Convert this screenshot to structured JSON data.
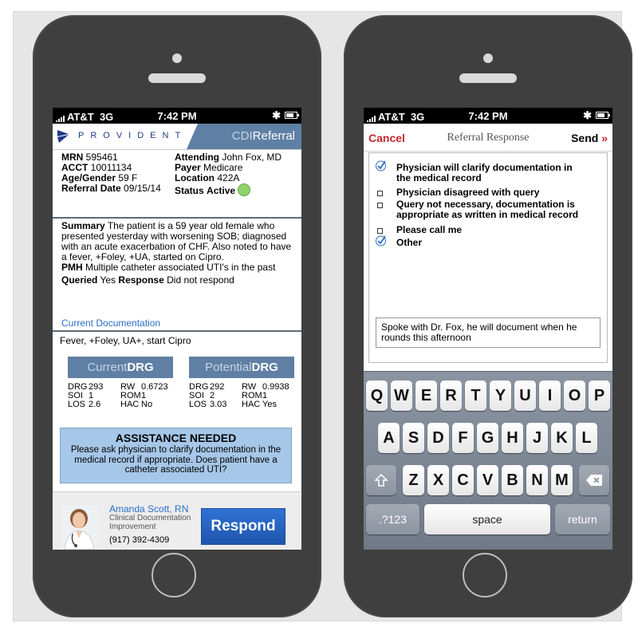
{
  "left_screen": {
    "status": {
      "carrier": "AT&T",
      "network": "3G",
      "time": "7:42 PM",
      "bluetooth": "✱"
    },
    "brand": {
      "name": "PROVIDENT",
      "product_light": "CDI",
      "product_bold": "Referral"
    },
    "patient": {
      "mrn_label": "MRN",
      "mrn": "595461",
      "acct_label": "ACCT",
      "acct": "10011134",
      "age_label": "Age/Gender",
      "age": "59 F",
      "refdate_label": "Referral Date",
      "refdate": "09/15/14",
      "attending_label": "Attending",
      "attending": "John Fox, MD",
      "payer_label": "Payer",
      "payer": "Medicare",
      "location_label": "Location",
      "location": "422A",
      "status_label": "Status",
      "status": "Active"
    },
    "summary": {
      "summary_label": "Summary",
      "summary_text": "The patient is a 59 year old female who presented yesterday with worsening SOB; diagnosed with an acute exacerbation of CHF. Also noted to have a fever, +Foley, +UA, started on Cipro.",
      "pmh_label": "PMH",
      "pmh_text": "Multiple catheter associated  UTI's in the past",
      "queried_label": "Queried",
      "queried": "Yes",
      "response_label": "Response",
      "response": "Did not respond"
    },
    "current_doc_link": "Current Documentation",
    "current_doc_text": "Fever, +Foley, UA+, start Cipro",
    "current_drg": {
      "title_light": "Current",
      "title_bold": "DRG",
      "rows": [
        {
          "k1": "DRG",
          "v1": "293",
          "k2": "RW",
          "v2": "0.6723"
        },
        {
          "k1": "SOI",
          "v1": "1",
          "k2": "ROM",
          "v2": "1"
        },
        {
          "k1": "LOS",
          "v1": "2.6",
          "k2": "HAC",
          "v2": "No"
        }
      ]
    },
    "potential_drg": {
      "title_light": "Potential",
      "title_bold": "DRG",
      "rows": [
        {
          "k1": "DRG",
          "v1": "292",
          "k2": "RW",
          "v2": "0.9938"
        },
        {
          "k1": "SOI",
          "v1": "2",
          "k2": "ROM",
          "v2": "1"
        },
        {
          "k1": "LOS",
          "v1": "3.03",
          "k2": "HAC",
          "v2": "Yes"
        }
      ]
    },
    "assistance": {
      "title": "ASSISTANCE NEEDED",
      "text": "Please ask physician to clarify documentation in the medical record if appropriate. Does patient have a catheter associated UTI?"
    },
    "contact": {
      "name": "Amanda Scott, RN",
      "role": "Clinical Documentation Improvement",
      "phone": "(917) 392-4309"
    },
    "respond_label": "Respond"
  },
  "right_screen": {
    "status": {
      "carrier": "AT&T",
      "network": "3G",
      "time": "7:42 PM",
      "bluetooth": "✱"
    },
    "nav": {
      "cancel": "Cancel",
      "title": "Referral Response",
      "send": "Send",
      "send_chevron": "»"
    },
    "options": [
      {
        "text": "Physician will clarify documentation in the medical record",
        "checked": true
      },
      {
        "text": "Physician disagreed with query",
        "checked": false
      },
      {
        "text": "Query not necessary, documentation is appropriate as written in medical record",
        "checked": false
      },
      {
        "text": "Please call me",
        "checked": false
      },
      {
        "text": "Other",
        "checked": true
      }
    ],
    "note": "Spoke with Dr. Fox, he will document when he rounds this afternoon",
    "keyboard": {
      "row1": [
        "Q",
        "W",
        "E",
        "R",
        "T",
        "Y",
        "U",
        "I",
        "O",
        "P"
      ],
      "row2": [
        "A",
        "S",
        "D",
        "F",
        "G",
        "H",
        "J",
        "K",
        "L"
      ],
      "row3": [
        "Z",
        "X",
        "C",
        "V",
        "B",
        "N",
        "M"
      ],
      "numbers_key": ".?123",
      "space_key": "space",
      "return_key": "return"
    }
  },
  "colors": {
    "brand_blue": "#1f3c88",
    "header_slate": "#5f7fa4",
    "respond_blue": "#2f73d4",
    "cancel_red": "#c0282d",
    "assist_bg": "#a6c7e8"
  }
}
